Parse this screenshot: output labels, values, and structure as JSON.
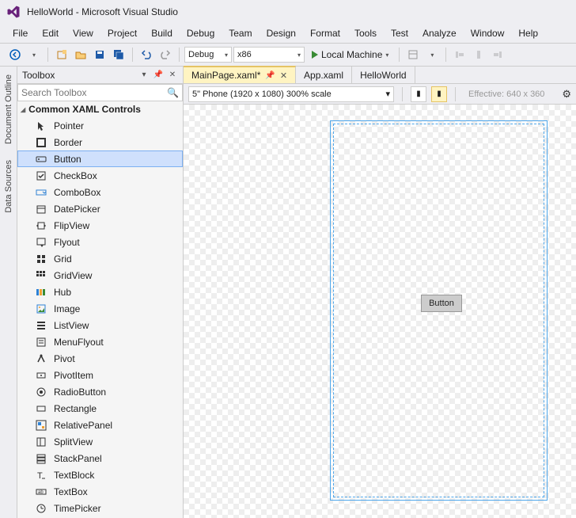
{
  "window_title": "HelloWorld - Microsoft Visual Studio",
  "menus": [
    "File",
    "Edit",
    "View",
    "Project",
    "Build",
    "Debug",
    "Team",
    "Design",
    "Format",
    "Tools",
    "Test",
    "Analyze",
    "Window",
    "Help"
  ],
  "toolbar": {
    "config": "Debug",
    "platform": "x86",
    "run_label": "Local Machine"
  },
  "side_tabs": [
    "Document Outline",
    "Data Sources"
  ],
  "toolbox": {
    "title": "Toolbox",
    "search_placeholder": "Search Toolbox",
    "category": "Common XAML Controls",
    "items": [
      "Pointer",
      "Border",
      "Button",
      "CheckBox",
      "ComboBox",
      "DatePicker",
      "FlipView",
      "Flyout",
      "Grid",
      "GridView",
      "Hub",
      "Image",
      "ListView",
      "MenuFlyout",
      "Pivot",
      "PivotItem",
      "RadioButton",
      "Rectangle",
      "RelativePanel",
      "SplitView",
      "StackPanel",
      "TextBlock",
      "TextBox",
      "TimePicker"
    ],
    "selected": "Button"
  },
  "doc_tabs": [
    {
      "label": "MainPage.xaml*",
      "active": true,
      "pinned": true
    },
    {
      "label": "App.xaml",
      "active": false
    },
    {
      "label": "HelloWorld",
      "active": false
    }
  ],
  "designer": {
    "device_combo": "5\" Phone (1920 x 1080) 300% scale",
    "effective": "Effective: 640 x 360",
    "button_label": "Button"
  }
}
